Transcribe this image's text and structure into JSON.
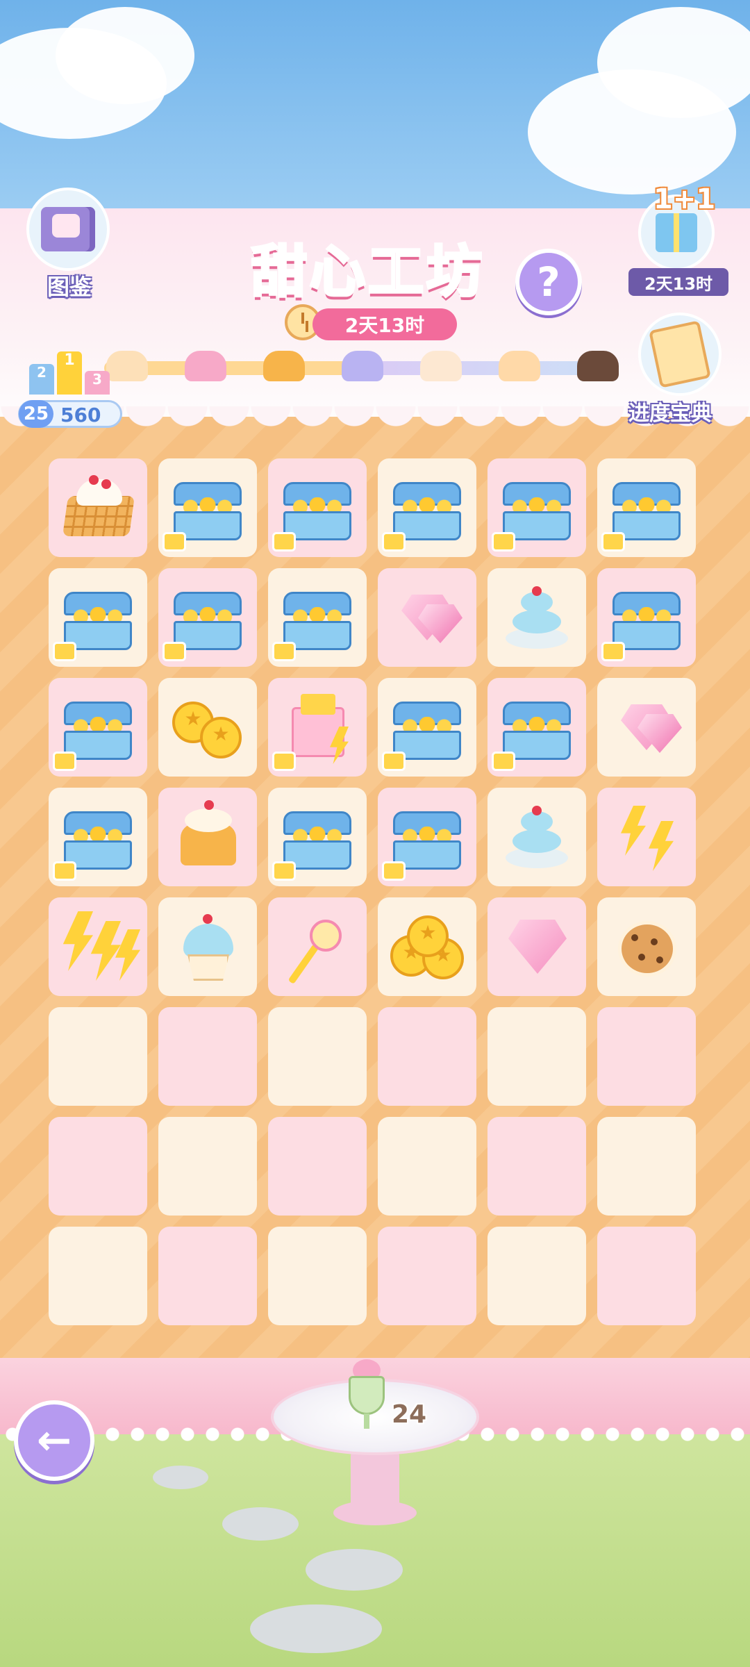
{
  "header": {
    "title": "甜心工坊",
    "timer": "2天13时",
    "help_symbol": "?"
  },
  "book": {
    "label": "图鉴",
    "icon": "book-icon"
  },
  "gift": {
    "promo": "1+1",
    "timer": "2天13时",
    "icon": "gift-box-icon"
  },
  "rank": {
    "level": "25",
    "points": "560",
    "podium_numbers": [
      "2",
      "1",
      "3"
    ]
  },
  "progress_book": {
    "label": "进度宝典",
    "icon": "recipe-book-icon"
  },
  "progress": {
    "fraction": 0.52,
    "milestones": [
      "donut",
      "macaron",
      "pudding",
      "blueberry-cake",
      "roll-cake",
      "strawberry-dessert",
      "chocolate-cake"
    ]
  },
  "board": {
    "rows": 8,
    "cols": 6,
    "cells": [
      [
        "waffle-dessert",
        "coin-chest",
        "coin-chest",
        "coin-chest",
        "coin-chest",
        "coin-chest"
      ],
      [
        "coin-chest",
        "coin-chest",
        "coin-chest",
        "pink-gems",
        "cupcake-stand",
        "coin-chest"
      ],
      [
        "coin-chest",
        "gold-coins",
        "gift-bag",
        "coin-chest",
        "coin-chest",
        "pink-gem-pile"
      ],
      [
        "coin-chest",
        "pudding",
        "coin-chest",
        "coin-chest",
        "cupcake-plate",
        "lightning-bolts"
      ],
      [
        "lightning-bolts-large",
        "cupcake",
        "magic-wand",
        "gold-coin-stack",
        "pink-gem",
        "cookie"
      ],
      [
        "",
        "",
        "",
        "",
        "",
        ""
      ],
      [
        "",
        "",
        "",
        "",
        "",
        ""
      ],
      [
        "",
        "",
        "",
        "",
        "",
        ""
      ]
    ],
    "colors": {
      "pink_cell": "#fddde3",
      "cream_cell": "#fdf2e2"
    }
  },
  "plate": {
    "item": "parfait",
    "count": "24"
  },
  "back": {
    "icon": "back-arrow-icon",
    "symbol": "←"
  },
  "colors": {
    "title": "#f58ab0",
    "timer_pill": "#f26b9b",
    "button_purple": "#b69af0"
  }
}
